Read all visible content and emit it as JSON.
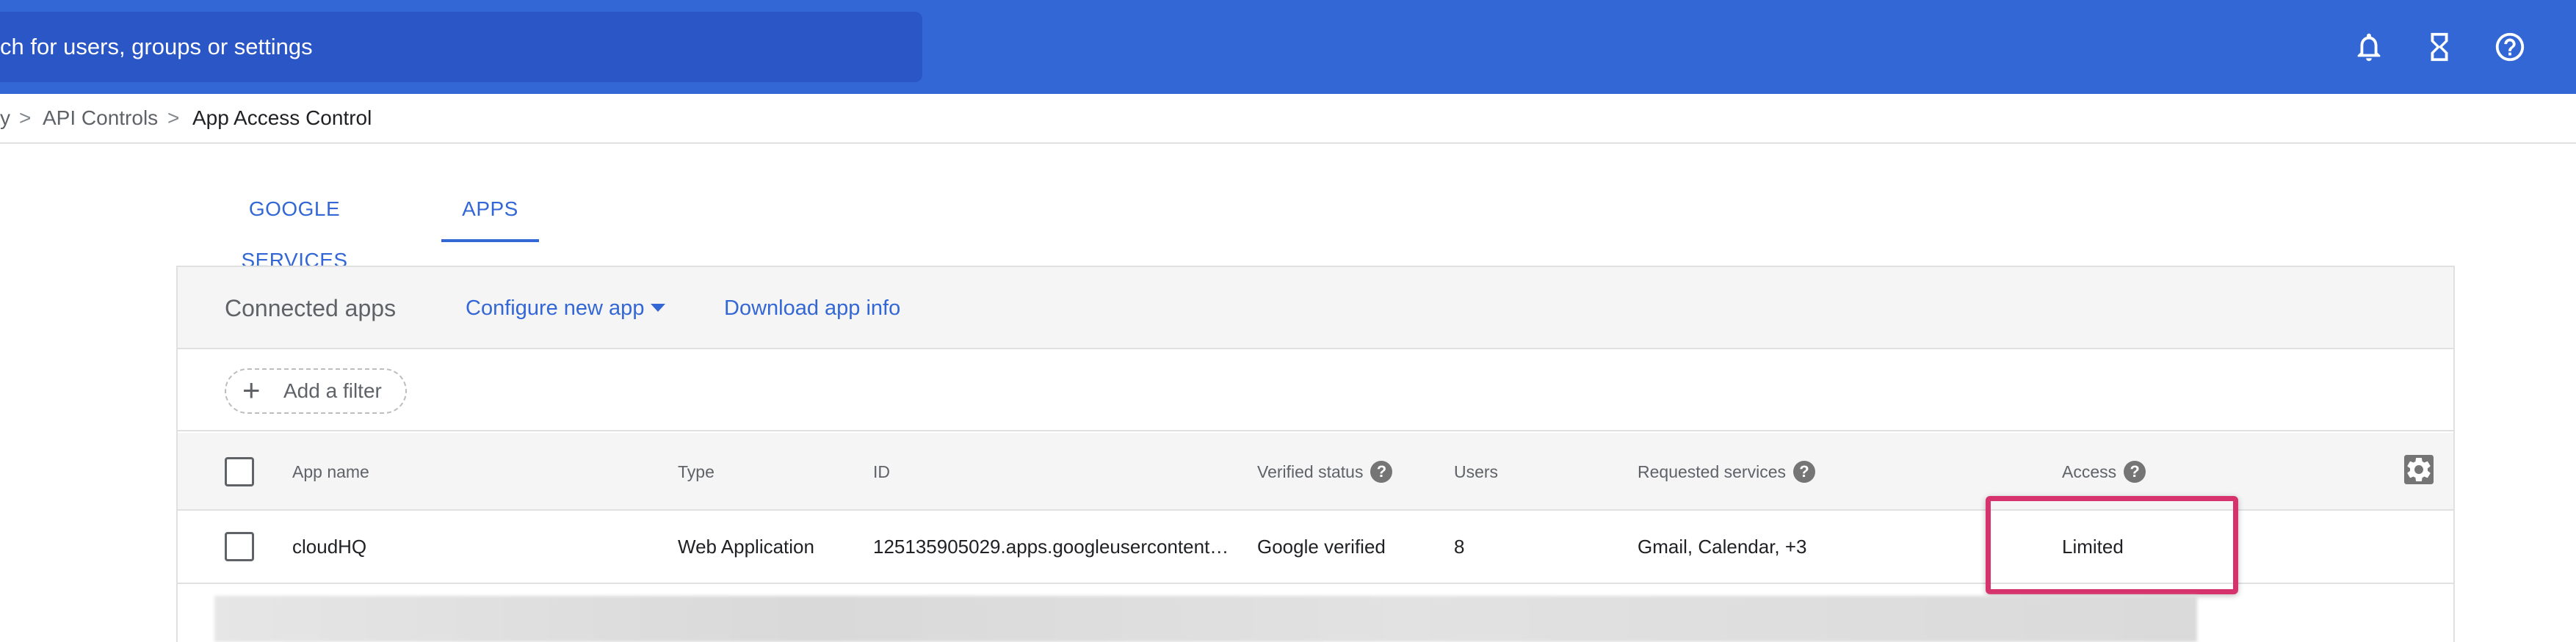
{
  "topbar": {
    "search_placeholder": "ch for users, groups or settings",
    "icons": [
      "bell-icon",
      "hourglass-icon",
      "help-circle-icon"
    ],
    "colors": {
      "bar": "#3367d6",
      "search": "#2a56c6"
    }
  },
  "breadcrumb": {
    "items": [
      "y",
      "API Controls",
      "App Access Control"
    ],
    "separator": ">"
  },
  "tabs": [
    {
      "label": "GOOGLE SERVICES",
      "active": false
    },
    {
      "label": "APPS",
      "active": true
    }
  ],
  "card": {
    "title": "Connected apps",
    "configure_label": "Configure new app",
    "download_label": "Download app info",
    "filter_label": "Add a filter"
  },
  "table": {
    "columns": [
      "App name",
      "Type",
      "ID",
      "Verified status",
      "Users",
      "Requested services",
      "Access"
    ],
    "rows": [
      {
        "app_name": "cloudHQ",
        "type": "Web Application",
        "id": "125135905029.apps.googleusercontent…",
        "verified_status": "Google verified",
        "users": "8",
        "requested_services": "Gmail, Calendar, +3",
        "access": "Limited"
      }
    ]
  },
  "highlight_color": "#d6336c"
}
